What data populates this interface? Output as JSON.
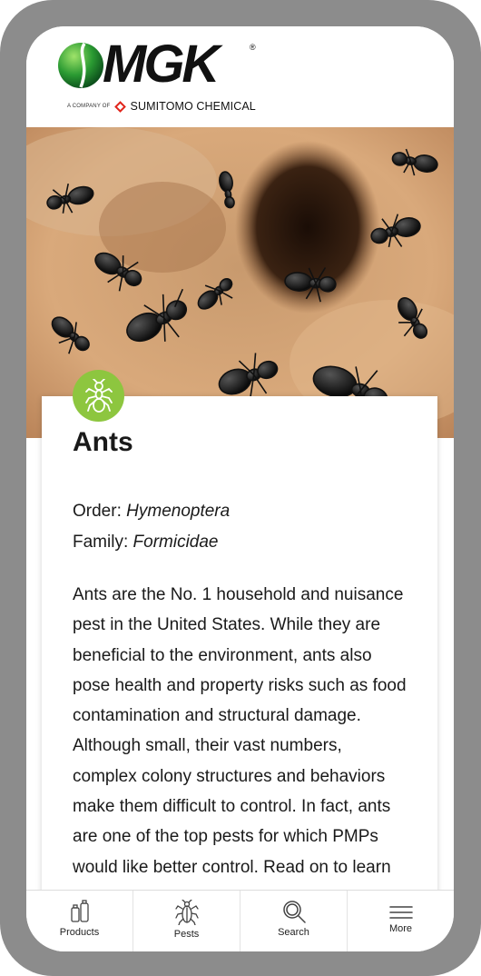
{
  "brand": {
    "name": "MGK",
    "registered_mark": "®",
    "tagline_prefix": "A COMPANY OF",
    "tagline_company": "SUMITOMO CHEMICAL",
    "brand_green": "#8dc63f",
    "accent_red": "#e1251b"
  },
  "hero": {
    "image": "ants-on-soil-photo"
  },
  "pest": {
    "icon": "ant-icon",
    "title": "Ants",
    "order_label": "Order:",
    "order_value": "Hymenoptera",
    "family_label": "Family:",
    "family_value": "Formicidae",
    "description": "Ants are the No. 1 household and nuisance pest in the United States. While they are beneficial to the environment, ants also pose health and property risks such as food contamination and structural damage. Although small, their vast numbers, complex colony structures and behaviors make them difficult to control. In fact, ants are one of the top pests for which PMPs would like better control. Read on to learn more, get resources and"
  },
  "tabbar": {
    "items": [
      {
        "label": "Products",
        "icon": "spray-bottle-icon"
      },
      {
        "label": "Pests",
        "icon": "bug-icon"
      },
      {
        "label": "Search",
        "icon": "search-icon"
      },
      {
        "label": "More",
        "icon": "menu-icon"
      }
    ]
  }
}
